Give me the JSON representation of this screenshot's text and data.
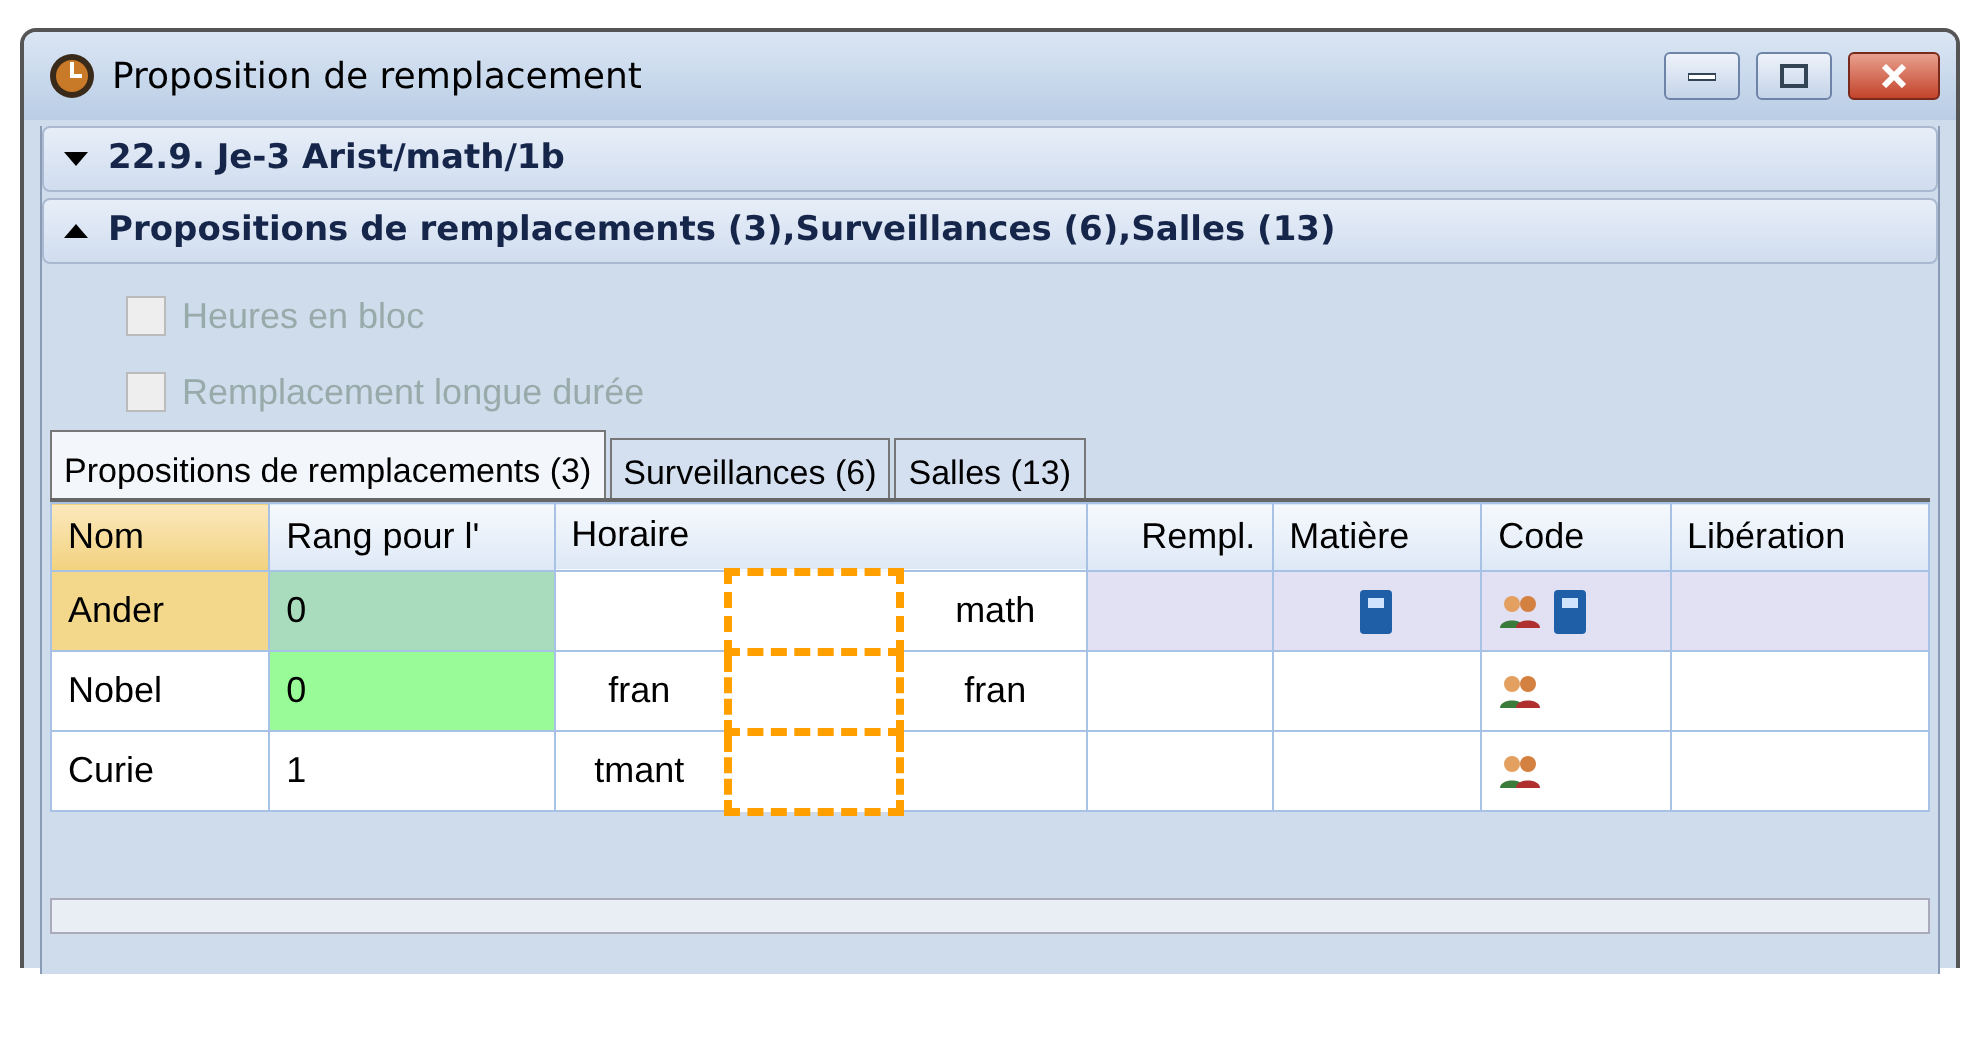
{
  "window": {
    "title": "Proposition de remplacement"
  },
  "sections": [
    {
      "label": "22.9. Je-3 Arist/math/1b",
      "expanded": false
    },
    {
      "label": "Propositions de remplacements (3),Surveillances (6),Salles (13)",
      "expanded": true
    }
  ],
  "options": [
    {
      "label": "Heures en bloc",
      "checked": false,
      "disabled": true
    },
    {
      "label": "Remplacement longue durée",
      "checked": false,
      "disabled": true
    }
  ],
  "tabs": [
    {
      "label": "Propositions de remplacements (3)",
      "selected": true
    },
    {
      "label": "Surveillances (6)",
      "selected": false
    },
    {
      "label": "Salles (13)",
      "selected": false
    }
  ],
  "table": {
    "columns": [
      "Nom",
      "Rang pour l'",
      "Horaire",
      "Rempl.",
      "Matière",
      "Code",
      "Libération"
    ],
    "rows": [
      {
        "name": "Ander",
        "rank": "0",
        "rank_highlighted": true,
        "slot_before": "",
        "slot_after": "math",
        "subject_icon": true,
        "code_icons": [
          {
            "kind": "group"
          },
          {
            "kind": "book"
          }
        ],
        "selected": true
      },
      {
        "name": "Nobel",
        "rank": "0",
        "rank_highlighted": true,
        "slot_before": "fran",
        "slot_after": "fran",
        "subject_icon": false,
        "code_icons": [
          {
            "kind": "group"
          }
        ],
        "selected": false
      },
      {
        "name": "Curie",
        "rank": "1",
        "rank_highlighted": false,
        "slot_before": "tmant",
        "slot_after": "",
        "subject_icon": false,
        "code_icons": [
          {
            "kind": "group"
          }
        ],
        "selected": false
      }
    ]
  }
}
